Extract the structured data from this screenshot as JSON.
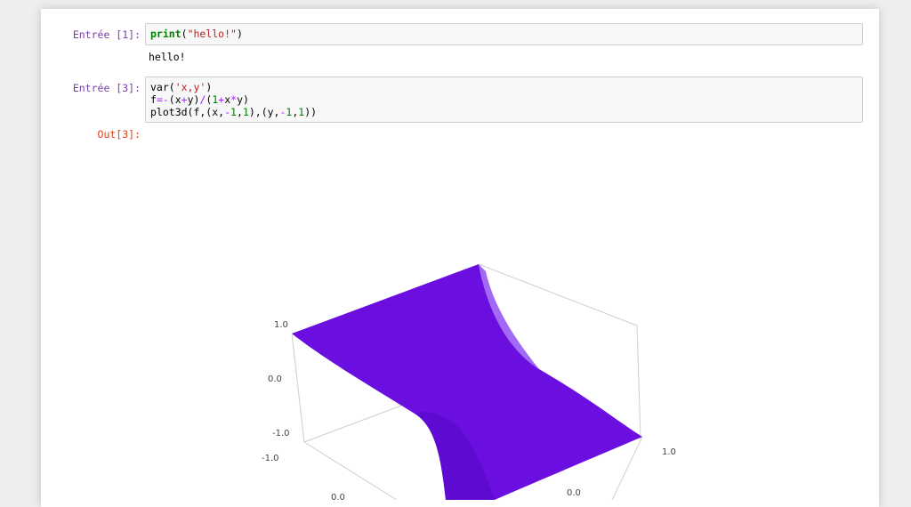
{
  "cells": [
    {
      "in_prompt": "Entrée [1]:",
      "code": {
        "fn": "print",
        "open": "(",
        "str": "\"hello!\"",
        "close": ")"
      },
      "output": "hello!"
    },
    {
      "in_prompt": "Entrée [3]:",
      "code": {
        "l1_a": "var(",
        "l1_str": "'x,y'",
        "l1_b": ")",
        "l2_a": "f",
        "l2_eq": "=-",
        "l2_b": "(x",
        "l2_plus": "+",
        "l2_c": "y)",
        "l2_div": "/",
        "l2_d": "(",
        "l2_one": "1",
        "l2_plus2": "+",
        "l2_e": "x",
        "l2_mul": "*",
        "l2_f": "y)",
        "l3_a": "plot3d(f,(x,",
        "l3_neg1": "-",
        "l3_one1": "1",
        "l3_b": ",",
        "l3_one2": "1",
        "l3_c": "),(y,",
        "l3_neg2": "-",
        "l3_one3": "1",
        "l3_d": ",",
        "l3_one4": "1",
        "l3_e": "))"
      },
      "out_prompt": "Out[3]:"
    }
  ],
  "plot": {
    "surface_color": "#6a0fe0",
    "ticks": {
      "z_top": "1.0",
      "z_mid": "0.0",
      "z_bottom": "-1.0",
      "y_left": "-1.0",
      "y_mid": "0.0",
      "x_right": "1.0",
      "x_mid": "0.0"
    }
  }
}
